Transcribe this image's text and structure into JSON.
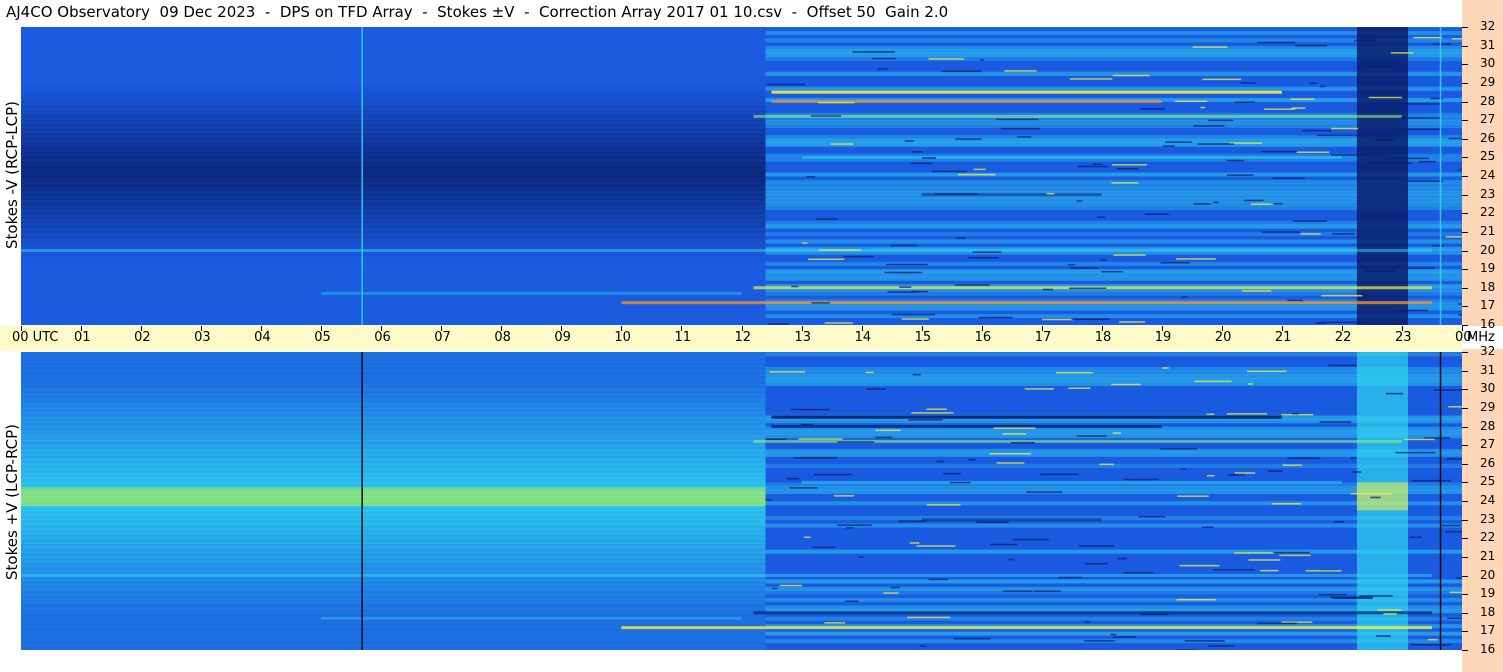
{
  "title": "AJ4CO Observatory  09 Dec 2023  -  DPS on TFD Array  -  Stokes ±V  -  Correction Array 2017 01 10.csv  -  Offset 50  Gain 2.0",
  "chart_data": {
    "type": "heatmap",
    "panels": [
      {
        "ylabel": "Stokes -V (RCP-LCP)",
        "tone": "dark"
      },
      {
        "ylabel": "Stokes +V (LCP-RCP)",
        "tone": "light"
      }
    ],
    "x_ticks": [
      "00 UTC",
      "01",
      "02",
      "03",
      "04",
      "05",
      "06",
      "07",
      "08",
      "09",
      "10",
      "11",
      "12",
      "13",
      "14",
      "15",
      "16",
      "17",
      "18",
      "19",
      "20",
      "21",
      "22",
      "23",
      "00"
    ],
    "y_ticks": [
      32,
      31,
      30,
      29,
      28,
      27,
      26,
      25,
      24,
      23,
      22,
      21,
      20,
      19,
      18,
      17,
      16
    ],
    "y_unit": "MHz",
    "xlim": [
      0,
      24
    ],
    "ylim": [
      16,
      32
    ],
    "colors": {
      "deep": "#0a1f6e",
      "base": "#1a5be0",
      "cyan": "#2fd4f0",
      "green": "#8ef07a",
      "yellow": "#f5f040",
      "orange": "#f09030"
    }
  }
}
